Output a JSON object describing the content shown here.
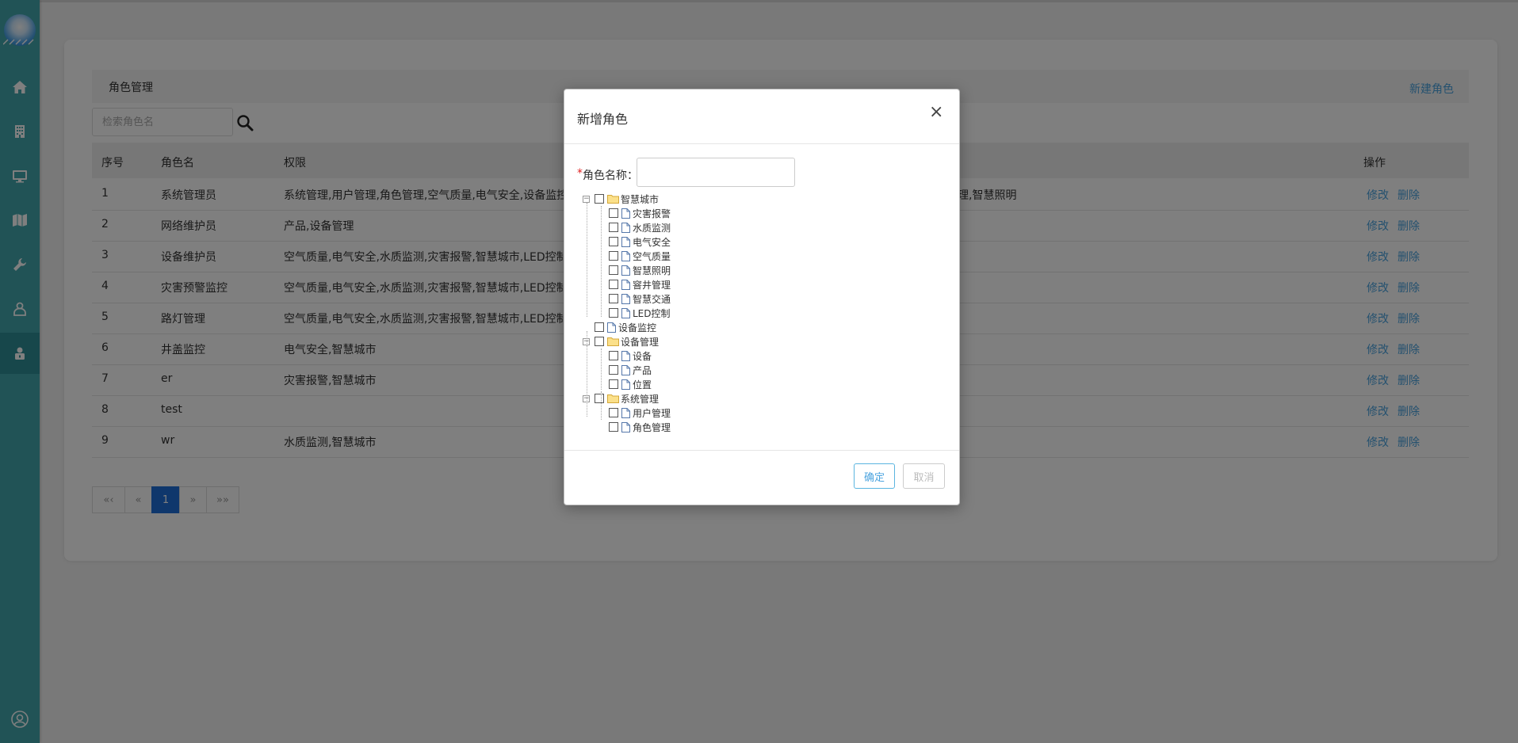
{
  "page": {
    "title": "角色管理",
    "new_role": "新建角色",
    "search_placeholder": "检索角色名"
  },
  "table": {
    "headers": {
      "no": "序号",
      "name": "角色名",
      "perm": "权限",
      "ops": "操作"
    },
    "rows": [
      {
        "no": "1",
        "name": "系统管理员",
        "perm": "系统管理,用户管理,角色管理,空气质量,电气安全,设备监控",
        "perm_tail": "理,智慧照明"
      },
      {
        "no": "2",
        "name": "网络维护员",
        "perm": "产品,设备管理",
        "perm_tail": ""
      },
      {
        "no": "3",
        "name": "设备维护员",
        "perm": "空气质量,电气安全,水质监测,灾害报警,智慧城市,LED控制,",
        "perm_tail": ""
      },
      {
        "no": "4",
        "name": "灾害预警监控",
        "perm": "空气质量,电气安全,水质监测,灾害报警,智慧城市,LED控制,",
        "perm_tail": ""
      },
      {
        "no": "5",
        "name": "路灯管理",
        "perm": "空气质量,电气安全,水质监测,灾害报警,智慧城市,LED控制,",
        "perm_tail": ""
      },
      {
        "no": "6",
        "name": "井盖监控",
        "perm": "电气安全,智慧城市",
        "perm_tail": ""
      },
      {
        "no": "7",
        "name": "er",
        "perm": "灾害报警,智慧城市",
        "perm_tail": ""
      },
      {
        "no": "8",
        "name": "test",
        "perm": "",
        "perm_tail": ""
      },
      {
        "no": "9",
        "name": "wr",
        "perm": "水质监测,智慧城市",
        "perm_tail": ""
      }
    ],
    "edit_label": "修改",
    "delete_label": "删除"
  },
  "pagination": {
    "first": "«‹",
    "prev": "«",
    "current": "1",
    "next": "»",
    "last": "»»"
  },
  "modal": {
    "title": "新增角色",
    "close": "×",
    "name_label": "角色名称：",
    "required_mark": "*",
    "tree": [
      {
        "label": "智慧城市",
        "level": 0,
        "type": "folder",
        "expanded": true
      },
      {
        "label": "灾害报警",
        "level": 1,
        "type": "file"
      },
      {
        "label": "水质监测",
        "level": 1,
        "type": "file"
      },
      {
        "label": "电气安全",
        "level": 1,
        "type": "file"
      },
      {
        "label": "空气质量",
        "level": 1,
        "type": "file"
      },
      {
        "label": "智慧照明",
        "level": 1,
        "type": "file"
      },
      {
        "label": "窨井管理",
        "level": 1,
        "type": "file"
      },
      {
        "label": "智慧交通",
        "level": 1,
        "type": "file"
      },
      {
        "label": "LED控制",
        "level": 1,
        "type": "file"
      },
      {
        "label": "设备监控",
        "level": 0,
        "type": "file"
      },
      {
        "label": "设备管理",
        "level": 0,
        "type": "folder",
        "expanded": true
      },
      {
        "label": "设备",
        "level": 1,
        "type": "file"
      },
      {
        "label": "产品",
        "level": 1,
        "type": "file"
      },
      {
        "label": "位置",
        "level": 1,
        "type": "file"
      },
      {
        "label": "系统管理",
        "level": 0,
        "type": "folder",
        "expanded": true
      },
      {
        "label": "用户管理",
        "level": 1,
        "type": "file"
      },
      {
        "label": "角色管理",
        "level": 1,
        "type": "file"
      }
    ],
    "ok": "确定",
    "cancel": "取消"
  },
  "sidebar": {
    "items": [
      {
        "icon": "home-icon"
      },
      {
        "icon": "building-icon"
      },
      {
        "icon": "monitor-icon"
      },
      {
        "icon": "map-icon"
      },
      {
        "icon": "wrench-icon"
      },
      {
        "icon": "user-lock-icon"
      },
      {
        "icon": "role-lock-icon",
        "active": true
      }
    ],
    "bottom_icon": "user-circle-icon"
  },
  "colors": {
    "sidebar": "#43a6ad",
    "sidebar_active": "#2f8f97",
    "link": "#4aa3df",
    "pager_active": "#1e6fd9",
    "required": "#e02020"
  }
}
